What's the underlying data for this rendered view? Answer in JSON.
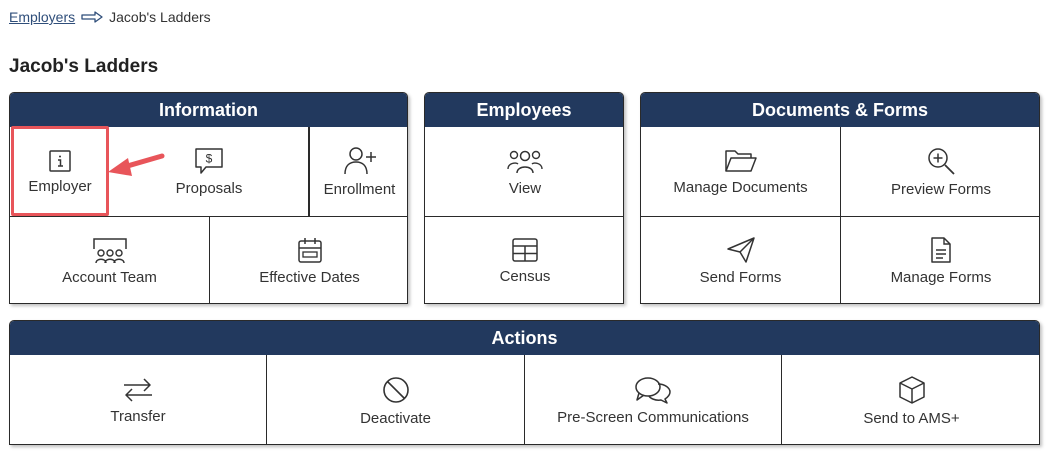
{
  "breadcrumb": {
    "parent": "Employers",
    "current": "Jacob's Ladders"
  },
  "page_title": "Jacob's Ladders",
  "information": {
    "header": "Information",
    "employer": "Employer",
    "proposals": "Proposals",
    "enrollment": "Enrollment",
    "account_team": "Account Team",
    "effective_dates": "Effective Dates"
  },
  "employees": {
    "header": "Employees",
    "view": "View",
    "census": "Census"
  },
  "documents": {
    "header": "Documents & Forms",
    "manage_documents": "Manage Documents",
    "preview_forms": "Preview Forms",
    "send_forms": "Send Forms",
    "manage_forms": "Manage Forms"
  },
  "actions": {
    "header": "Actions",
    "transfer": "Transfer",
    "deactivate": "Deactivate",
    "pre_screen": "Pre-Screen Communications",
    "send_ams": "Send to AMS+"
  },
  "colors": {
    "header_bg": "#22395e",
    "highlight": "#e8555a",
    "link": "#2f4e7a"
  }
}
